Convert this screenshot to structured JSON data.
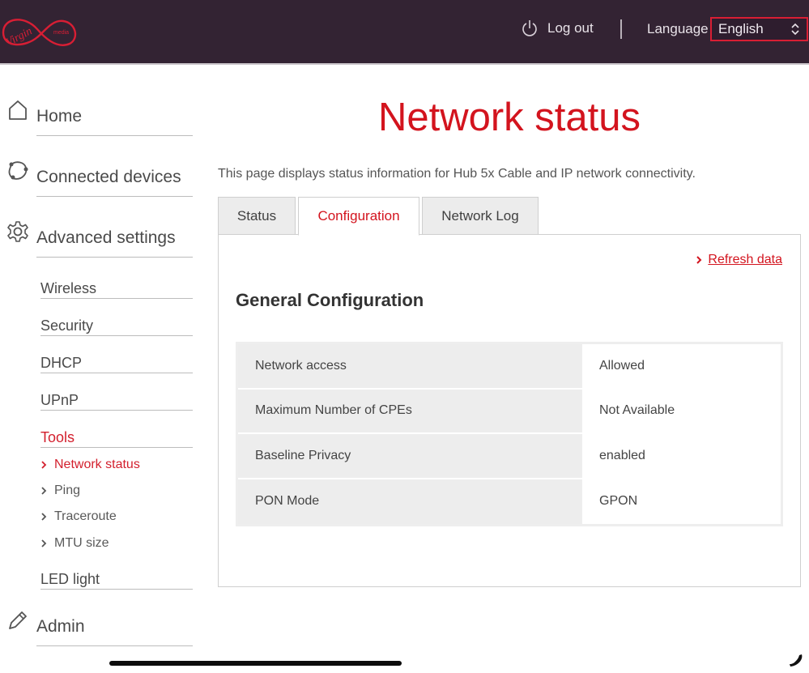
{
  "header": {
    "logo": {
      "brand_text": "Virgin",
      "sub_text": "media",
      "icon": "virgin-media-logo"
    },
    "logout_label": "Log out",
    "language_label": "Language",
    "language_selected": "English"
  },
  "sidebar": {
    "main": [
      {
        "label": "Home",
        "icon": "home-icon"
      },
      {
        "label": "Connected devices",
        "icon": "devices-icon"
      },
      {
        "label": "Advanced settings",
        "icon": "gear-icon"
      },
      {
        "label": "Admin",
        "icon": "pencil-icon"
      }
    ],
    "advanced": [
      {
        "label": "Wireless"
      },
      {
        "label": "Security"
      },
      {
        "label": "DHCP"
      },
      {
        "label": "UPnP"
      },
      {
        "label": "Tools",
        "active": true
      },
      {
        "label": "LED light"
      }
    ],
    "tools": [
      {
        "label": "Network status",
        "active": true
      },
      {
        "label": "Ping"
      },
      {
        "label": "Traceroute"
      },
      {
        "label": "MTU size"
      }
    ]
  },
  "main": {
    "title": "Network status",
    "intro": "This page displays status information for Hub 5x Cable and IP network connectivity.",
    "tabs": [
      {
        "label": "Status"
      },
      {
        "label": "Configuration",
        "active": true
      },
      {
        "label": "Network Log"
      }
    ],
    "refresh_label": "Refresh data",
    "section_title": "General Configuration",
    "config_rows": [
      {
        "key": "Network access",
        "value": "Allowed"
      },
      {
        "key": "Maximum Number of CPEs",
        "value": "Not Available"
      },
      {
        "key": "Baseline Privacy",
        "value": "enabled"
      },
      {
        "key": "PON Mode",
        "value": "GPON"
      }
    ]
  },
  "colors": {
    "header_bg": "#332333",
    "accent_red": "#d3141e",
    "select_border": "#d81e34"
  }
}
